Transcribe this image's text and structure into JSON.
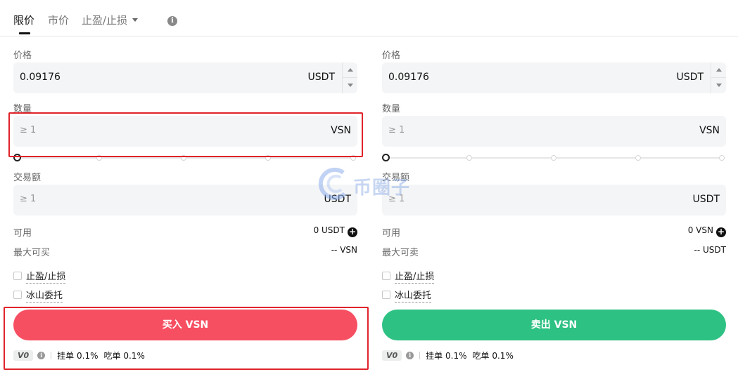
{
  "tabs": {
    "limit": "限价",
    "market": "市价",
    "tpsl": "止盈/止损"
  },
  "buy": {
    "price_label": "价格",
    "price_value": "0.09176",
    "price_unit": "USDT",
    "qty_label": "数量",
    "qty_placeholder": "≥ 1",
    "qty_unit": "VSN",
    "amount_label": "交易额",
    "amount_placeholder": "≥ 1",
    "amount_unit": "USDT",
    "available_label": "可用",
    "available_value": "0 USDT",
    "max_label": "最大可买",
    "max_value": "-- VSN",
    "tpsl_check": "止盈/止损",
    "iceberg_check": "冰山委托",
    "button": "买入 VSN",
    "vip": "V0",
    "maker": "挂单",
    "maker_rate": "0.1%",
    "taker": "吃单",
    "taker_rate": "0.1%"
  },
  "sell": {
    "price_label": "价格",
    "price_value": "0.09176",
    "price_unit": "USDT",
    "qty_label": "数量",
    "qty_placeholder": "≥ 1",
    "qty_unit": "VSN",
    "amount_label": "交易额",
    "amount_placeholder": "≥ 1",
    "amount_unit": "USDT",
    "available_label": "可用",
    "available_value": "0 VSN",
    "max_label": "最大可卖",
    "max_value": "-- USDT",
    "tpsl_check": "止盈/止损",
    "iceberg_check": "冰山委托",
    "button": "卖出 VSN",
    "vip": "V0",
    "maker": "挂单",
    "maker_rate": "0.1%",
    "taker": "吃单",
    "taker_rate": "0.1%"
  },
  "slider_value": 0,
  "watermark": "币圈子",
  "colors": {
    "buy": "#f74f62",
    "sell": "#2ec184",
    "highlight": "#e0242b"
  },
  "icons": [
    "info-icon",
    "caret-down-icon",
    "plus-circle-icon",
    "stepper-up-icon",
    "stepper-down-icon",
    "checkbox-icon",
    "watermark-logo-icon"
  ]
}
